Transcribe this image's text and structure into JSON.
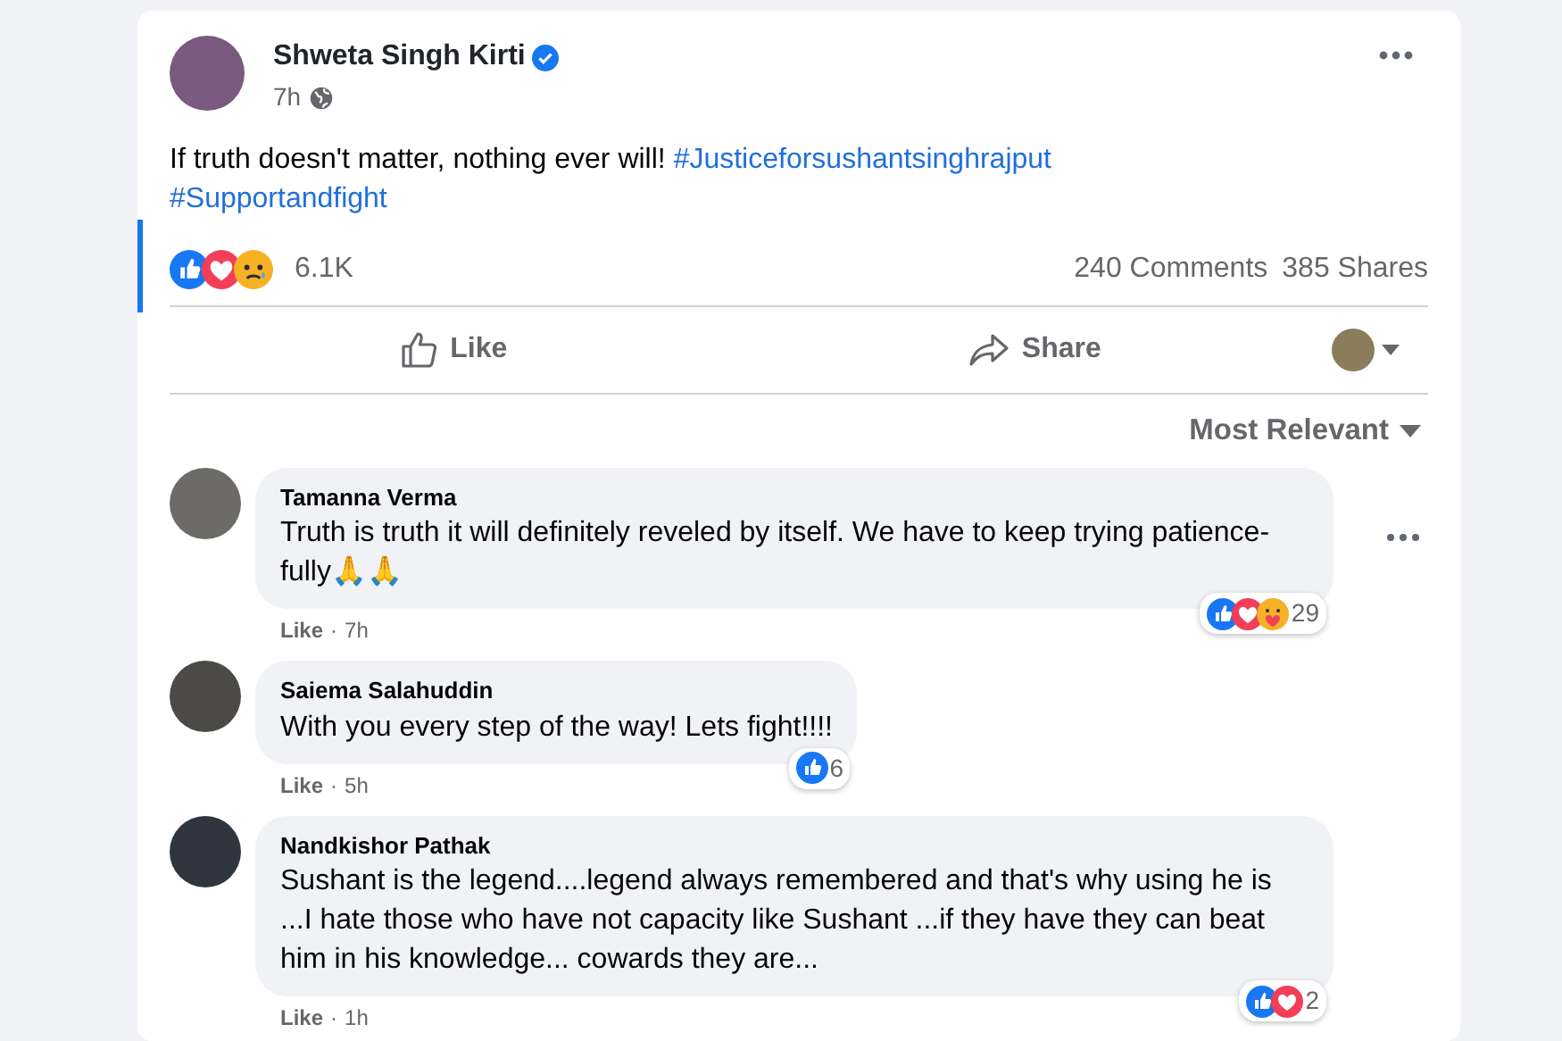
{
  "post": {
    "author": "Shweta Singh Kirti",
    "verified": true,
    "time": "7h",
    "text": "If truth doesn't matter, nothing ever will!",
    "hashtags": [
      "#Justiceforsushantsinghrajput",
      "#Supportandfight"
    ],
    "reactions": [
      {
        "kind": "like"
      },
      {
        "kind": "love"
      },
      {
        "kind": "sad"
      }
    ],
    "reaction_count": "6.1K",
    "comments_count": "240 Comments",
    "shares_count": "385 Shares",
    "actions": [
      {
        "kind": "like",
        "label": "Like"
      },
      {
        "kind": "share",
        "label": "Share"
      }
    ]
  },
  "sort": {
    "label": "Most Relevant"
  },
  "comments": [
    {
      "author": "Tamanna Verma",
      "text": "Truth is truth it will definitely reveled by itself. We have to keep trying patience-fully🙏🙏",
      "separator": "·",
      "like_label": "Like",
      "time": "7h",
      "reactions": [
        {
          "kind": "like"
        },
        {
          "kind": "love"
        },
        {
          "kind": "care"
        }
      ],
      "reaction_count": "29",
      "menu": true
    },
    {
      "author": "Saiema Salahuddin",
      "text": "With you every step of the way! Lets fight!!!!",
      "separator": "·",
      "like_label": "Like",
      "time": "5h",
      "reactions": [
        {
          "kind": "like"
        }
      ],
      "reaction_count": "6",
      "menu": false
    },
    {
      "author": "Nandkishor Pathak",
      "text": "Sushant is the legend....legend always remembered and that's why using he is ...I hate those who have not capacity like Sushant ...if they have they can beat him in his knowledge... cowards they are...",
      "separator": "·",
      "like_label": "Like",
      "time": "1h",
      "reactions": [
        {
          "kind": "like"
        },
        {
          "kind": "love"
        }
      ],
      "reaction_count": "2",
      "menu": false
    }
  ]
}
